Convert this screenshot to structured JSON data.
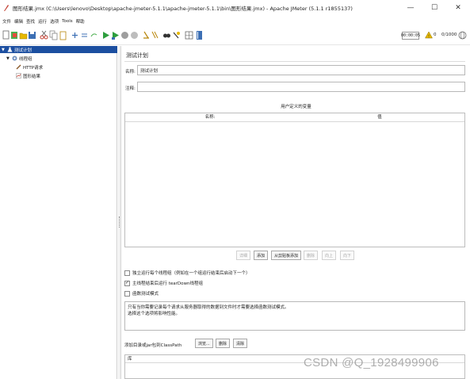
{
  "window": {
    "title": "图形结果.jmx (C:\\Users\\lenovo\\Desktop\\apache-jmeter-5.1.1\\apache-jmeter-5.1.1\\bin\\图形结果.jmx) - Apache JMeter (5.1.1 r1855137)",
    "minimize": "—",
    "maximize": "☐",
    "close": "✕"
  },
  "menu": [
    "文件",
    "编辑",
    "查找",
    "运行",
    "选项",
    "Tools",
    "帮助"
  ],
  "toolbar": {
    "timer": "00:00:05",
    "warning_count": "0",
    "threads": "0/1000",
    "warning_color": "#e6b800"
  },
  "tree": {
    "items": [
      {
        "label": "测试计划",
        "arrow": "▼",
        "icon": "flask-icon"
      },
      {
        "label": "线程组",
        "arrow": "▼",
        "icon": "gear-icon"
      },
      {
        "label": "HTTP请求",
        "arrow": "",
        "icon": "pen-icon"
      },
      {
        "label": "图形结果",
        "arrow": "",
        "icon": "chart-icon"
      }
    ]
  },
  "main": {
    "panel_title": "测试计划",
    "name_label": "名称:",
    "name_value": "测试计划",
    "comment_label": "注释:",
    "comment_value": "",
    "variables_title": "用户定义的变量",
    "columns": [
      "名称:",
      "值"
    ],
    "buttons": {
      "detail": "详细",
      "add": "添加",
      "add_clipboard": "从剪贴板添加",
      "delete": "删除",
      "up": "向上",
      "down": "向下"
    },
    "checkboxes": [
      {
        "label": "独立运行每个线程组（例如在一个组运行结束后启动下一个）",
        "checked": false
      },
      {
        "label": "主线程结束后运行 tearDown线程组",
        "checked": true
      },
      {
        "label": "函数测试模式",
        "checked": false
      }
    ],
    "description_lines": [
      "只有当你需要记录每个请求从服务器取得的数据到文件时才需要选择函数测试模式。",
      "选择这个选项将影响性能。"
    ],
    "classpath_label": "添加目录或jar包到ClassPath",
    "classpath_buttons": {
      "browse": "浏览...",
      "delete": "删除",
      "clear": "清除"
    },
    "lib_column": "库"
  },
  "watermark": "CSDN @Q_1928499906"
}
